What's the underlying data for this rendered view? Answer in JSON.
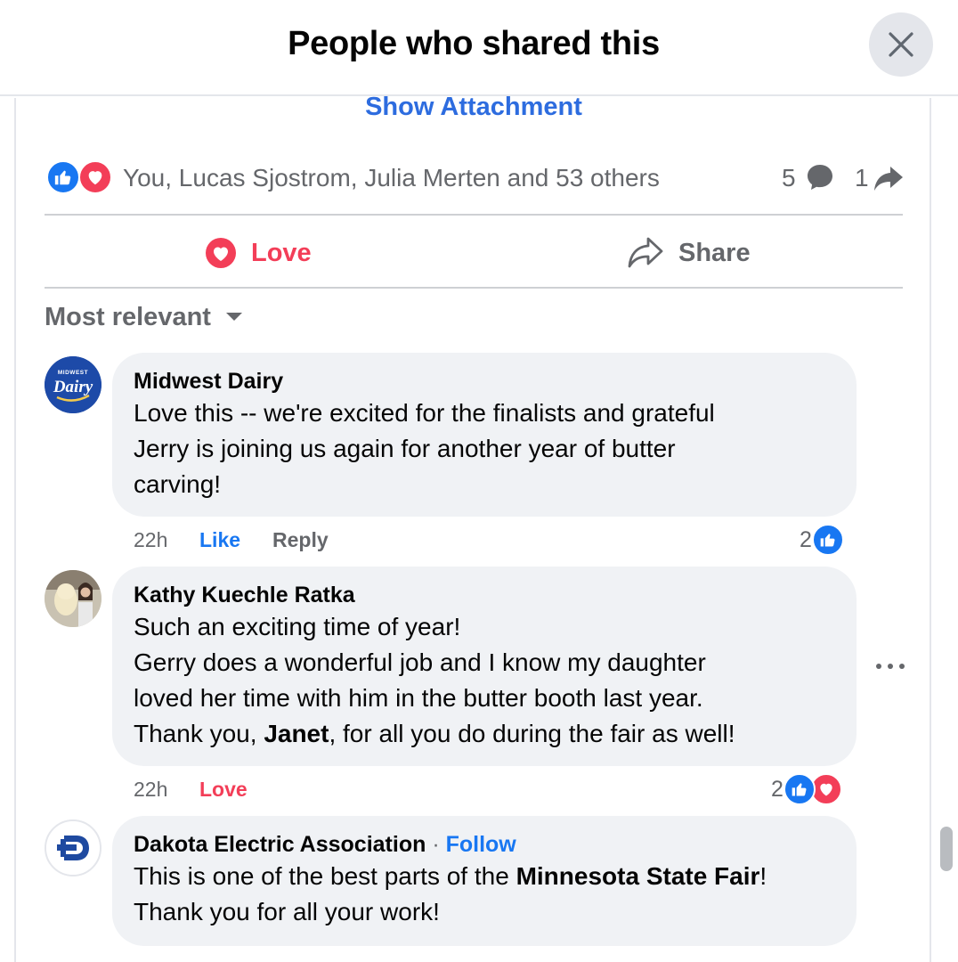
{
  "header": {
    "title": "People who shared this"
  },
  "post": {
    "show_attachment": "Show Attachment",
    "reactors_text": "You, Lucas Sjostrom, Julia Merten and 53 others",
    "comments_count": "5",
    "shares_count": "1",
    "love_label": "Love",
    "share_label": "Share"
  },
  "sort": {
    "label": "Most relevant"
  },
  "comments": [
    {
      "author": "Midwest Dairy",
      "lines": [
        "Love this -- we're excited for the finalists and grateful",
        "Jerry is joining us again for another year of butter",
        "carving!"
      ],
      "time": "22h",
      "action1": "Like",
      "action2": "Reply",
      "reaction_count": "2"
    },
    {
      "author": "Kathy Kuechle Ratka",
      "lines": [
        "Such an exciting time of year!",
        "Gerry does a wonderful job and I know my daughter",
        "loved her time with him in the butter booth last year."
      ],
      "line4_pre": "Thank you, ",
      "line4_bold": "Janet",
      "line4_post": ", for all you do during the fair as well!",
      "time": "22h",
      "action1": "Love",
      "reaction_count": "2"
    },
    {
      "author": "Dakota Electric Association",
      "separator": "·",
      "follow": "Follow",
      "line1_pre": "This is one of the best parts of the ",
      "line1_bold": "Minnesota State Fair",
      "line1_post": "!",
      "line2": "Thank you for all your work!"
    }
  ],
  "avatars": {
    "midwest_dairy_text": "Dairy",
    "midwest_top_text": "MIDWEST"
  },
  "colors": {
    "accent_blue": "#1877f2",
    "love_red": "#f33e58",
    "link_blue": "#2d6cdf",
    "bubble_bg": "#f0f2f5",
    "muted": "#65676b"
  }
}
